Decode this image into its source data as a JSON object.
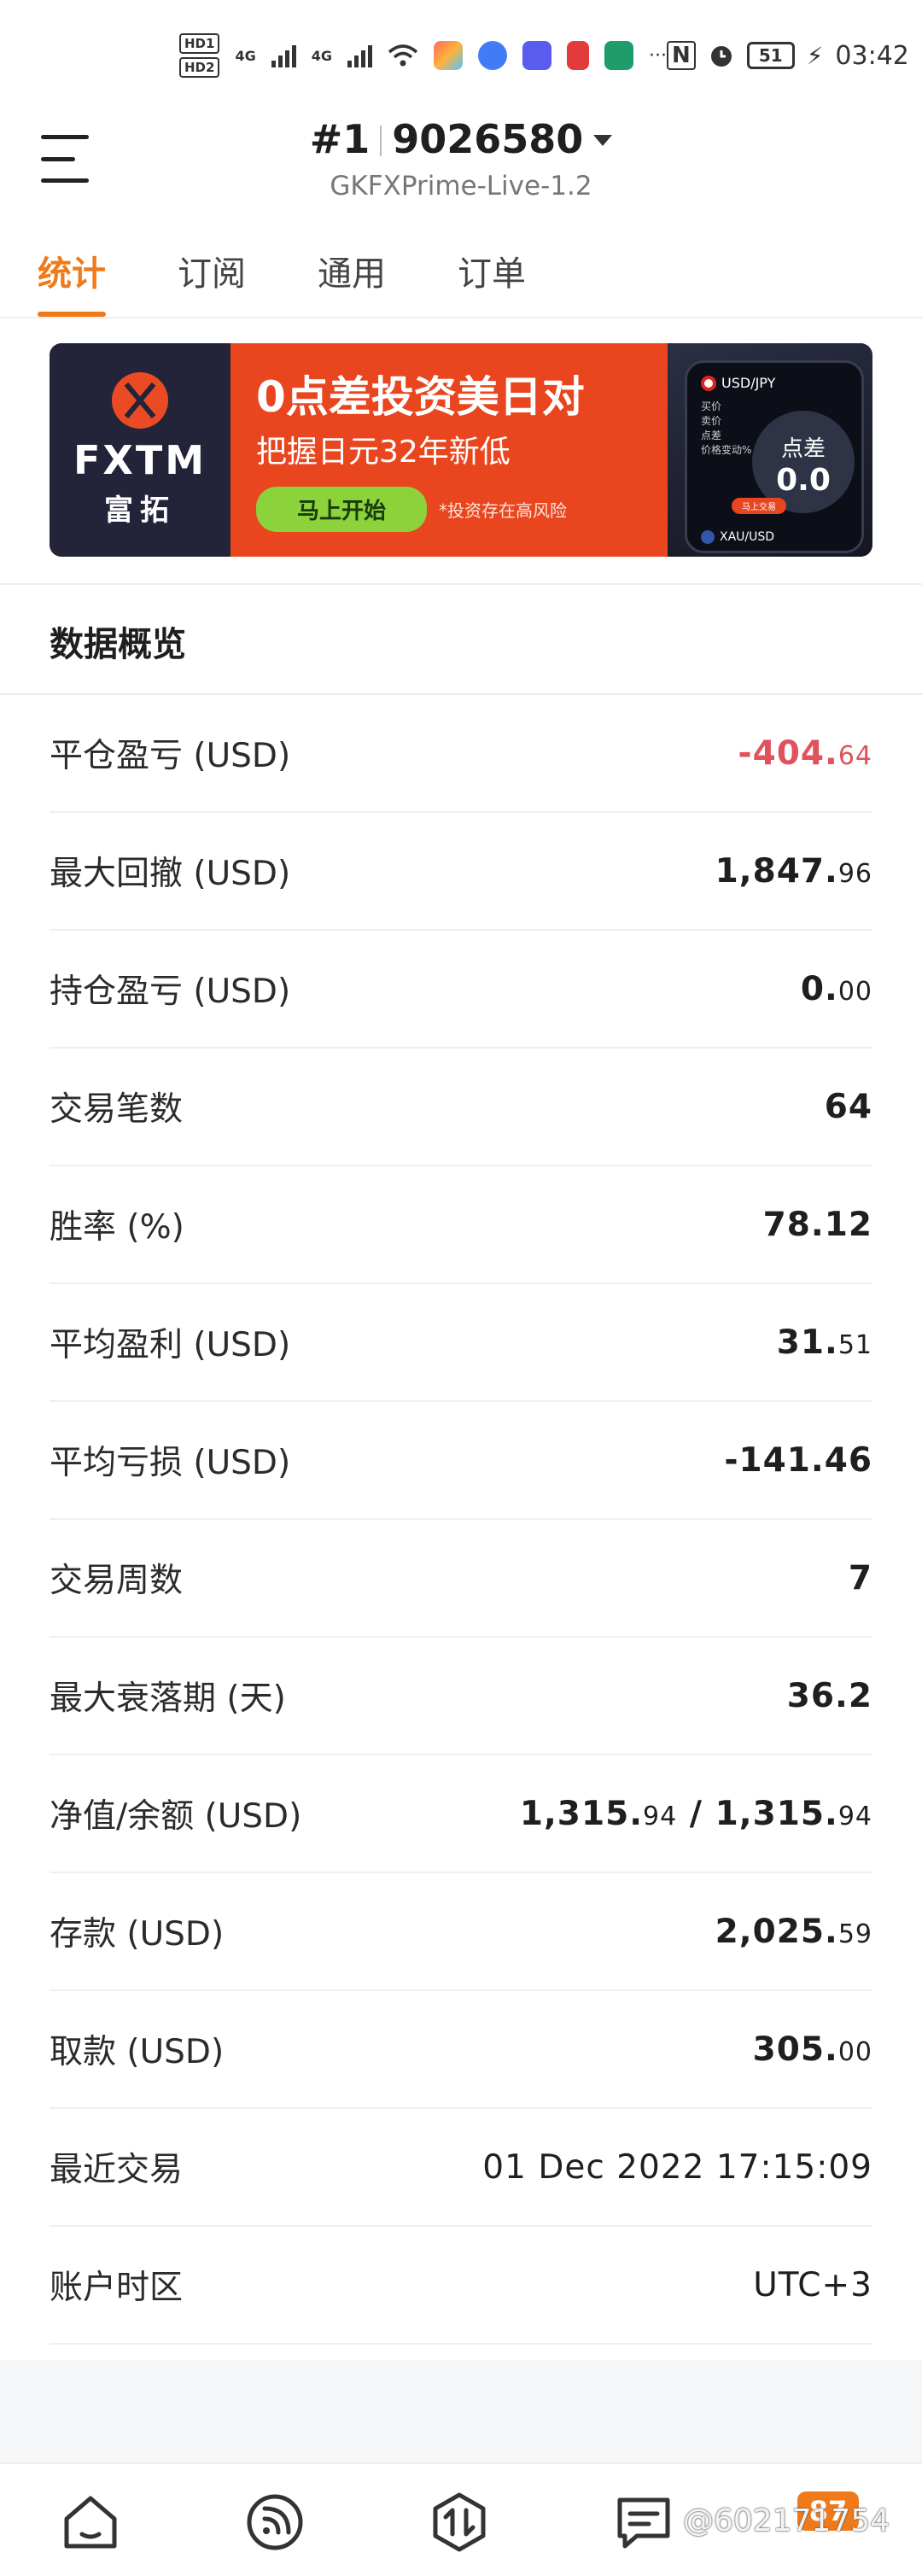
{
  "status_bar": {
    "hd1": "HD1",
    "hd2": "HD2",
    "net1": "4G",
    "net2": "4G",
    "more": "···",
    "battery": "51",
    "time": "03:42"
  },
  "header": {
    "account_prefix": "#1",
    "account_number": "9026580",
    "server": "GKFXPrime-Live-1.2"
  },
  "tabs": [
    {
      "label": "统计",
      "active": true
    },
    {
      "label": "订阅",
      "active": false
    },
    {
      "label": "通用",
      "active": false
    },
    {
      "label": "订单",
      "active": false
    }
  ],
  "banner": {
    "brand": "FXTM",
    "brand_cn": "富拓",
    "headline": "0点差投资美日对",
    "subline": "把握日元32年新低",
    "cta": "马上开始",
    "risk": "*投资存在高风险",
    "pair1": "USD/JPY",
    "lines": [
      "买价",
      "卖价",
      "点差",
      "价格变动%"
    ],
    "spread_label": "点差",
    "spread_value": "0.0",
    "phone_btn": "马上交易",
    "pair2": "XAU/USD"
  },
  "section": {
    "title": "数据概览"
  },
  "stats": [
    {
      "label": "平仓盈亏 (USD)",
      "int": "-404.",
      "dec": "64",
      "negative": true
    },
    {
      "label": "最大回撤 (USD)",
      "int": "1,847.",
      "dec": "96",
      "negative": false
    },
    {
      "label": "持仓盈亏 (USD)",
      "int": "0.",
      "dec": "00",
      "negative": false
    },
    {
      "label": "交易笔数",
      "int": "64",
      "dec": "",
      "negative": false
    },
    {
      "label": "胜率 (%)",
      "int": "78.12",
      "dec": "",
      "negative": false
    },
    {
      "label": "平均盈利 (USD)",
      "int": "31.",
      "dec": "51",
      "negative": false
    },
    {
      "label": "平均亏损 (USD)",
      "int": "-141.46",
      "dec": "",
      "negative": false
    },
    {
      "label": "交易周数",
      "int": "7",
      "dec": "",
      "negative": false
    },
    {
      "label": "最大衰落期 (天)",
      "int": "36.2",
      "dec": "",
      "negative": false
    },
    {
      "label": "净值/余额 (USD)",
      "int": "1,315.",
      "dec": "94",
      "int2": " / 1,315.",
      "dec2": "94",
      "negative": false
    },
    {
      "label": "存款 (USD)",
      "int": "2,025.",
      "dec": "59",
      "negative": false
    },
    {
      "label": "取款 (USD)",
      "int": "305.",
      "dec": "00",
      "negative": false
    },
    {
      "label": "最近交易",
      "int": "01 Dec 2022 17:15:09",
      "dec": "",
      "negative": false
    },
    {
      "label": "账户时区",
      "int": "UTC+3",
      "dec": "",
      "negative": false
    }
  ],
  "bottom_nav": {
    "items": [
      "home-icon",
      "feed-icon",
      "trade-icon",
      "message-icon"
    ],
    "badge": "87",
    "watermark": "@602171754"
  },
  "colors": {
    "accent": "#f07a1a",
    "negative": "#e0535d",
    "banner": "#e9461f"
  }
}
